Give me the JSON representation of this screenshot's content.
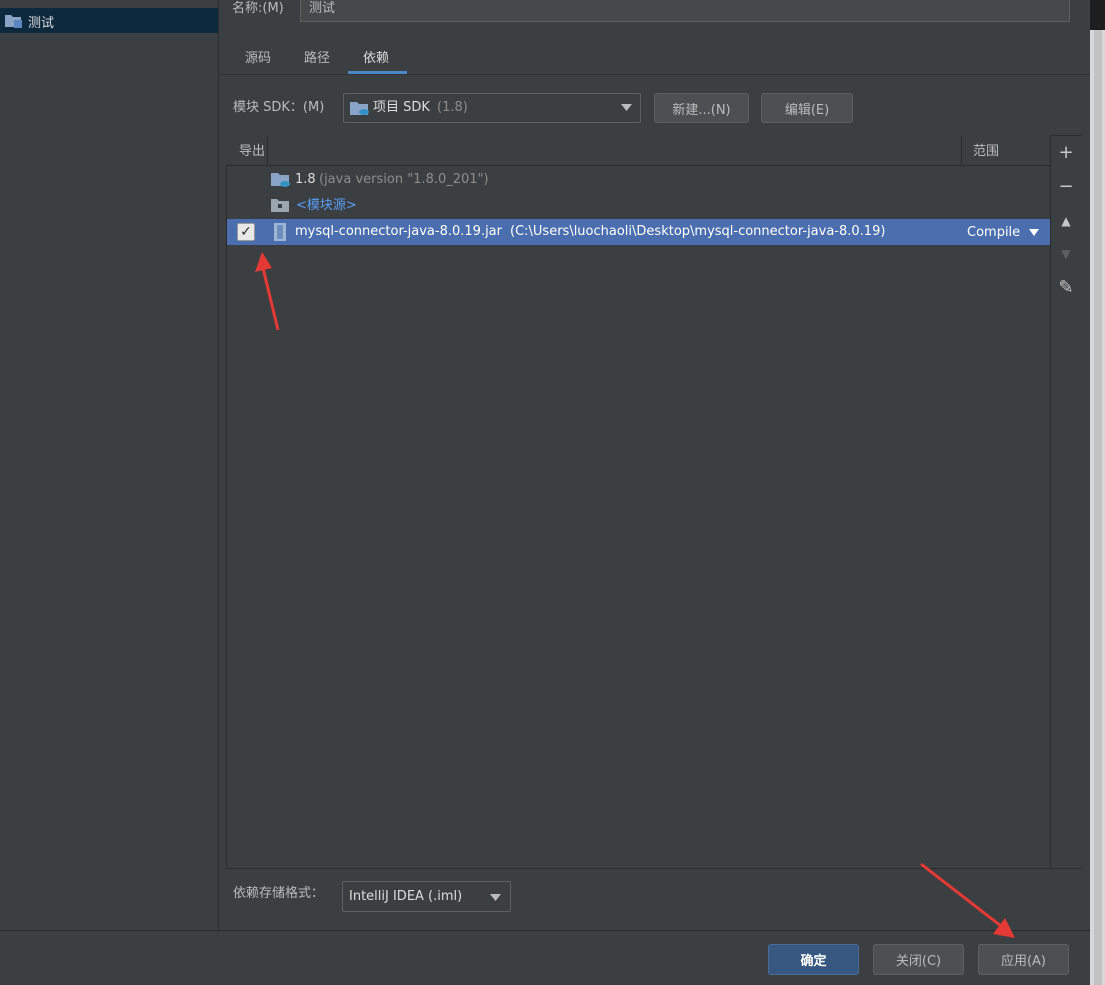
{
  "left_panel": {
    "module_name": "测试"
  },
  "name_row": {
    "label": "名称:(M)",
    "value": "测试"
  },
  "tabs": [
    {
      "label": "源码"
    },
    {
      "label": "路径"
    },
    {
      "label": "依赖"
    }
  ],
  "sdk_row": {
    "label": "模块 SDK：(M)",
    "selected": "项目 SDK",
    "selected_version": "(1.8)",
    "new_button": "新建...(N)",
    "edit_button": "编辑(E)"
  },
  "table": {
    "headers": {
      "export": "导出",
      "scope": "范围"
    },
    "rows": [
      {
        "name": "1.8",
        "detail": "(java version \"1.8.0_201\")"
      },
      {
        "name": "<模块源>",
        "detail": ""
      },
      {
        "name": "mysql-connector-java-8.0.19.jar",
        "detail": "(C:\\Users\\luochaoli\\Desktop\\mysql-connector-java-8.0.19)",
        "scope": "Compile",
        "checked": true
      }
    ]
  },
  "toolbar": {
    "add": "+",
    "remove": "−",
    "up": "▲",
    "down": "▼",
    "edit": "✎"
  },
  "storage": {
    "label": "依赖存储格式：",
    "value": "IntelliJ IDEA (.iml)"
  },
  "buttons": {
    "ok": "确定",
    "close": "关闭(C)",
    "apply": "应用(A)"
  },
  "colors": {
    "accent": "#4a88c7",
    "selection": "#4b6eaf",
    "annotation_arrow": "#e53935"
  }
}
